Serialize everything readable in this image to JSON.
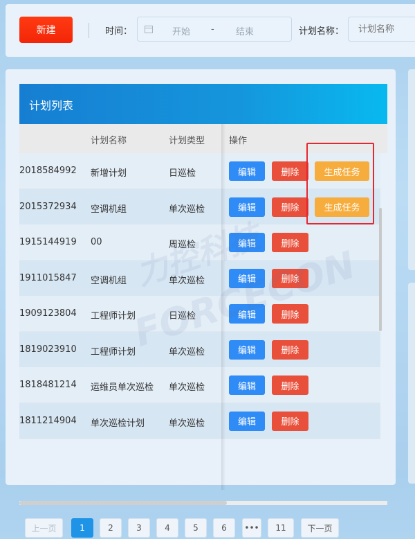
{
  "toolbar": {
    "new_label": "新建",
    "time_label": "时间：",
    "start_placeholder": "开始",
    "range_separator": "-",
    "end_placeholder": "结束",
    "plan_name_label": "计划名称：",
    "plan_name_placeholder": "计划名称"
  },
  "panel": {
    "title": "计划列表",
    "columns": [
      "计划名称",
      "计划类型",
      "操作"
    ],
    "rows": [
      {
        "id": "2018584992",
        "name": "新增计划",
        "type": "日巡检",
        "gen": true
      },
      {
        "id": "2015372934",
        "name": "空调机组",
        "type": "单次巡检",
        "gen": true
      },
      {
        "id": "1915144919",
        "name": "00",
        "type": "周巡检",
        "gen": false
      },
      {
        "id": "1911015847",
        "name": "空调机组",
        "type": "单次巡检",
        "gen": false
      },
      {
        "id": "1909123804",
        "name": "工程师计划",
        "type": "日巡检",
        "gen": false
      },
      {
        "id": "1819023910",
        "name": "工程师计划",
        "type": "单次巡检",
        "gen": false
      },
      {
        "id": "1818481214",
        "name": "运维员单次巡检",
        "type": "单次巡检",
        "gen": false
      },
      {
        "id": "1811214904",
        "name": "单次巡检计划",
        "type": "单次巡检",
        "gen": false
      }
    ],
    "actions": {
      "edit": "编辑",
      "delete": "删除",
      "generate": "生成任务"
    }
  },
  "pagination": {
    "prev": "上一页",
    "pages": [
      "1",
      "2",
      "3",
      "4",
      "5",
      "6"
    ],
    "ellipsis": "•••",
    "last": "11",
    "next": "下一页",
    "current": "1"
  },
  "watermark": {
    "line1": "力控科技",
    "line2": "FORCECON"
  },
  "colors": {
    "primary": "#2f8bf5",
    "danger": "#e8503b",
    "warning": "#f7ad3d",
    "new_button": "#f32607",
    "header": "#167ed2"
  }
}
